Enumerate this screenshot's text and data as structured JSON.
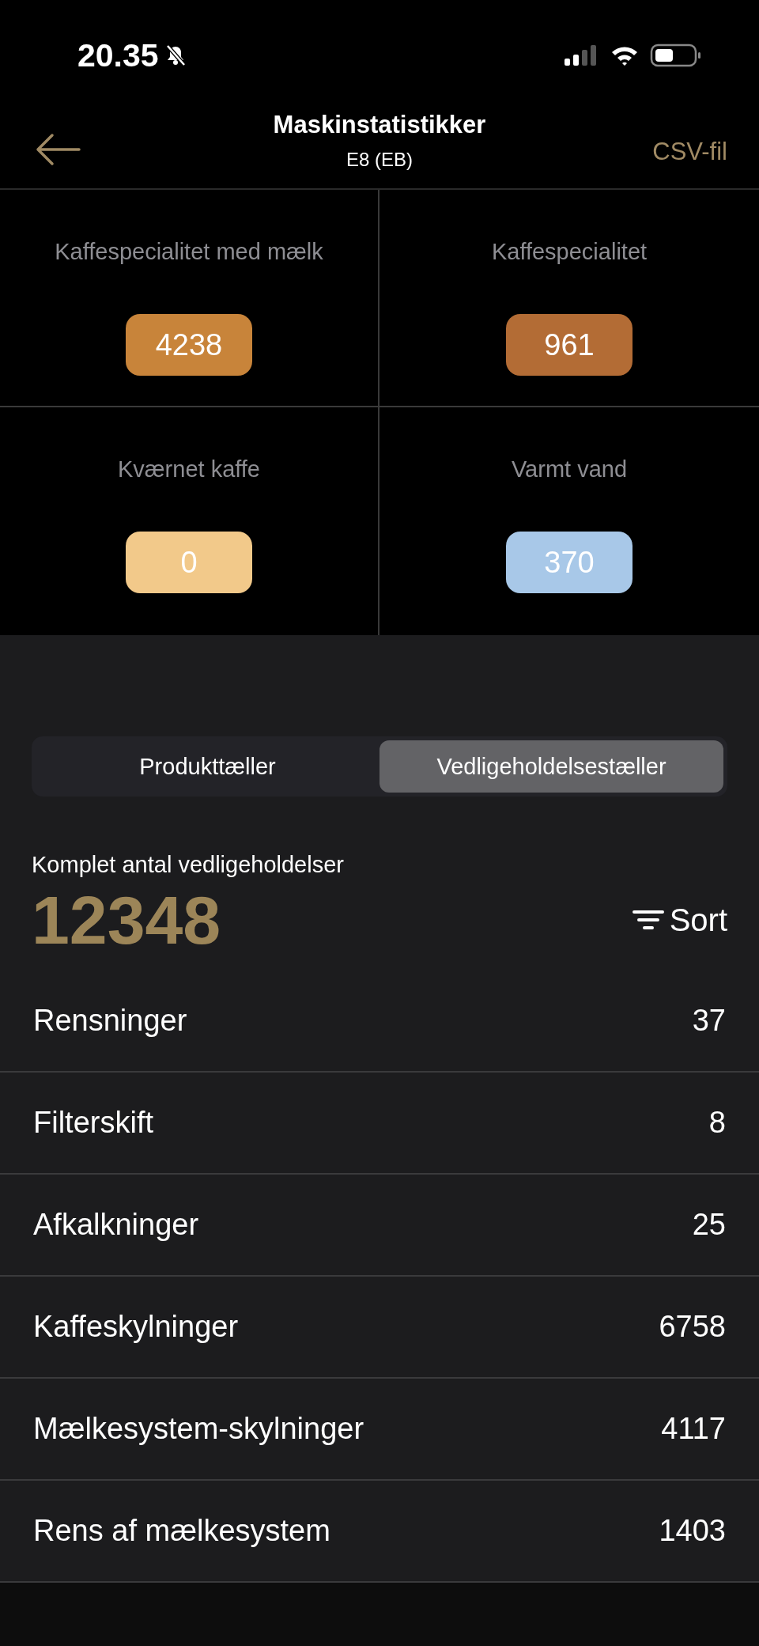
{
  "status_bar": {
    "time": "20.35"
  },
  "header": {
    "title": "Maskinstatistikker",
    "subtitle": "E8 (EB)",
    "action": "CSV-fil"
  },
  "tiles": [
    {
      "label": "Kaffespecialitet med mælk",
      "value": "4238",
      "color": "#c8843a"
    },
    {
      "label": "Kaffespecialitet",
      "value": "961",
      "color": "#b36c35"
    },
    {
      "label": "Kværnet kaffe",
      "value": "0",
      "color": "#f2c98a"
    },
    {
      "label": "Varmt vand",
      "value": "370",
      "color": "#a8c8e8"
    }
  ],
  "tabs": [
    {
      "label": "Produkttæller",
      "selected": false
    },
    {
      "label": "Vedligeholdelsestæller",
      "selected": true
    }
  ],
  "total": {
    "label": "Komplet antal vedligeholdelser",
    "value": "12348"
  },
  "sort": {
    "label": "Sort"
  },
  "rows": [
    {
      "label": "Rensninger",
      "value": "37"
    },
    {
      "label": "Filterskift",
      "value": "8"
    },
    {
      "label": "Afkalkninger",
      "value": "25"
    },
    {
      "label": "Kaffeskylninger",
      "value": "6758"
    },
    {
      "label": "Mælkesystem-skylninger",
      "value": "4117"
    },
    {
      "label": "Rens af mælkesystem",
      "value": "1403"
    }
  ]
}
